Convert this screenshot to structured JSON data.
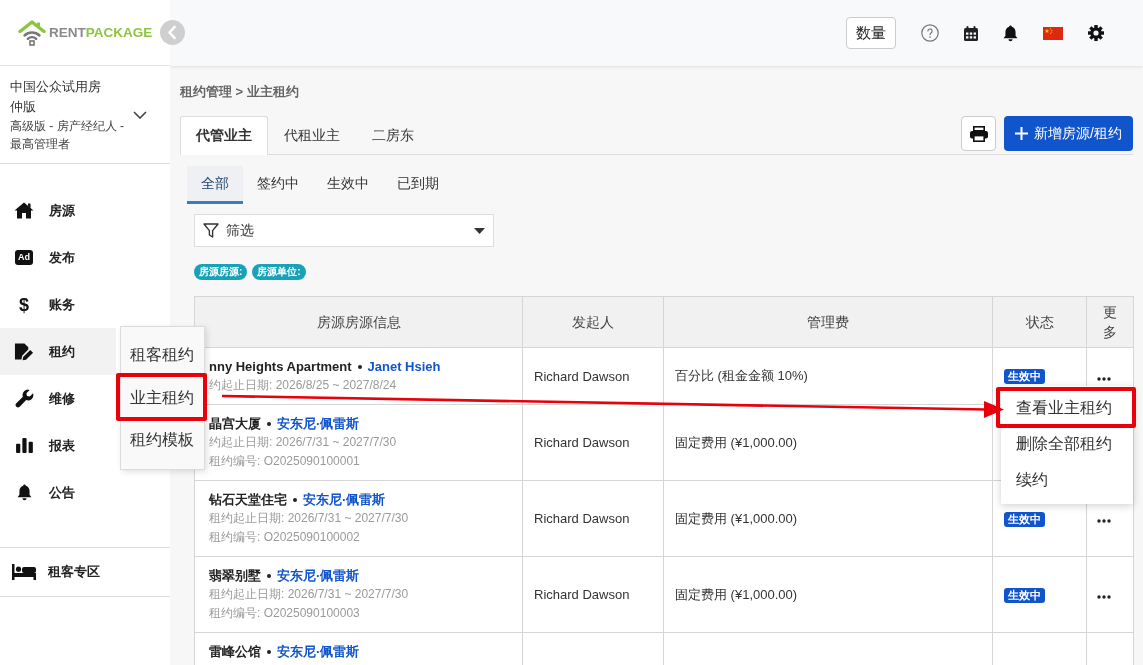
{
  "sidebar": {
    "logo": {
      "text_1": "RENT",
      "text_2": "PACKAGE"
    },
    "account": {
      "name": "中国公众试用房仲版",
      "role": "高级版 - 房产经纪人 - 最高管理者"
    },
    "items": [
      {
        "label": "房源",
        "selected": false
      },
      {
        "label": "发布",
        "icon_text": "Ad",
        "selected": false
      },
      {
        "label": "账务",
        "icon_text": "$",
        "selected": false
      },
      {
        "label": "租约",
        "selected": true,
        "submenu": [
          {
            "label": "租客租约",
            "highlighted": false
          },
          {
            "label": "业主租约",
            "highlighted": true
          },
          {
            "label": "租约模板",
            "highlighted": false
          }
        ]
      },
      {
        "label": "维修",
        "selected": false
      },
      {
        "label": "报表",
        "selected": false
      },
      {
        "label": "公告",
        "selected": false
      }
    ],
    "footer_items": [
      {
        "label": "租客专区"
      }
    ]
  },
  "header": {
    "count_button": "数量"
  },
  "breadcrumb": "租约管理 > 业主租约",
  "tabs": [
    {
      "label": "代管业主",
      "selected": true
    },
    {
      "label": "代租业主",
      "selected": false
    },
    {
      "label": "二房东",
      "selected": false
    }
  ],
  "new_button": "新增房源/租约",
  "status_tabs": [
    {
      "label": "全部",
      "selected": true
    },
    {
      "label": "签约中",
      "selected": false
    },
    {
      "label": "生效中",
      "selected": false
    },
    {
      "label": "已到期",
      "selected": false
    }
  ],
  "filter": {
    "label": "筛选"
  },
  "tags": [
    "房源房源:",
    "房源单位:"
  ],
  "table": {
    "columns": [
      "房源房源信息",
      "发起人",
      "管理费",
      "状态",
      "更多"
    ],
    "rows": [
      {
        "property": "nny Heights Apartment",
        "owner": "Janet Hsieh",
        "dates": "约起止日期: 2026/8/25 ~ 2027/8/24",
        "initiator": "Richard Dawson",
        "fee": "百分比 (租金金额 10%)",
        "status": "生效中",
        "more_button": true,
        "menu": {
          "items": [
            {
              "label": "查看业主租约",
              "highlighted": true
            },
            {
              "label": "删除全部租约",
              "highlighted": false
            },
            {
              "label": "续约",
              "highlighted": false
            }
          ]
        }
      },
      {
        "property": "晶宫大厦",
        "owner": "安东尼·佩雷斯",
        "dates": "约起止日期: 2026/7/31 ~ 2027/7/30",
        "contract_no": "租约编号: O2025090100001",
        "initiator": "Richard Dawson",
        "fee": "固定费用 (¥1,000.00)",
        "more_button": false
      },
      {
        "property": "钻石天堂住宅",
        "owner": "安东尼·佩雷斯",
        "dates": "租约起止日期: 2026/7/31 ~ 2027/7/30",
        "contract_no": "租约编号: O2025090100002",
        "initiator": "Richard Dawson",
        "fee": "固定费用 (¥1,000.00)",
        "status": "生效中",
        "more_button": true
      },
      {
        "property": "翡翠别墅",
        "owner": "安东尼·佩雷斯",
        "dates": "租约起止日期: 2026/7/31 ~ 2027/7/30",
        "contract_no": "租约编号: O2025090100003",
        "initiator": "Richard Dawson",
        "fee": "固定费用 (¥1,000.00)",
        "status": "生效中",
        "more_button": true
      },
      {
        "property": "雷峰公馆",
        "owner": "安东尼·佩雷斯",
        "more_button": false
      }
    ]
  }
}
